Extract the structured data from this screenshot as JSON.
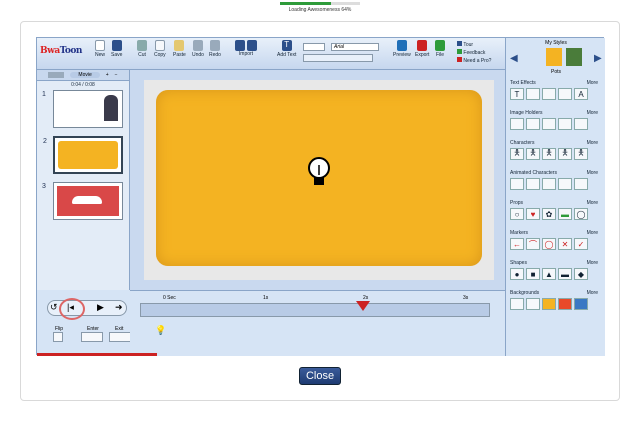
{
  "loading": {
    "text": "Loading Awesomeness 64%",
    "progress": 0.64
  },
  "toolbar": {
    "new": "New",
    "save": "Save",
    "cut": "Cut",
    "copy": "Copy",
    "paste": "Paste",
    "undo": "Undo",
    "redo": "Redo",
    "import": "Import",
    "add_text": "Add Text",
    "font": "Arial",
    "preview": "Preview",
    "export": "Export",
    "file": "File",
    "tour": "Tour",
    "feedback": "Feedback",
    "need_pro": "Need a Pro?"
  },
  "logo": {
    "a": "Bwa",
    "b": "Toon"
  },
  "sidebar": {
    "movie_label": "Movie",
    "time": "0:04 / 0:08",
    "slides": [
      "1",
      "2",
      "3"
    ]
  },
  "timeline": {
    "marks": [
      "0 Sec",
      "1s",
      "2s",
      "3s"
    ],
    "flip": "Flip",
    "enter": "Enter",
    "exit": "Exit"
  },
  "right": {
    "title": "My Styles",
    "subtitle": "Pots",
    "sections": [
      "Text Effects",
      "Image Holders",
      "Characters",
      "Animated Characters",
      "Props",
      "Markers",
      "Shapes",
      "Backgrounds"
    ],
    "more": "More"
  },
  "close_label": "Close",
  "colors": {
    "accent": "#f4b322",
    "nav": "#2c4f8a"
  }
}
